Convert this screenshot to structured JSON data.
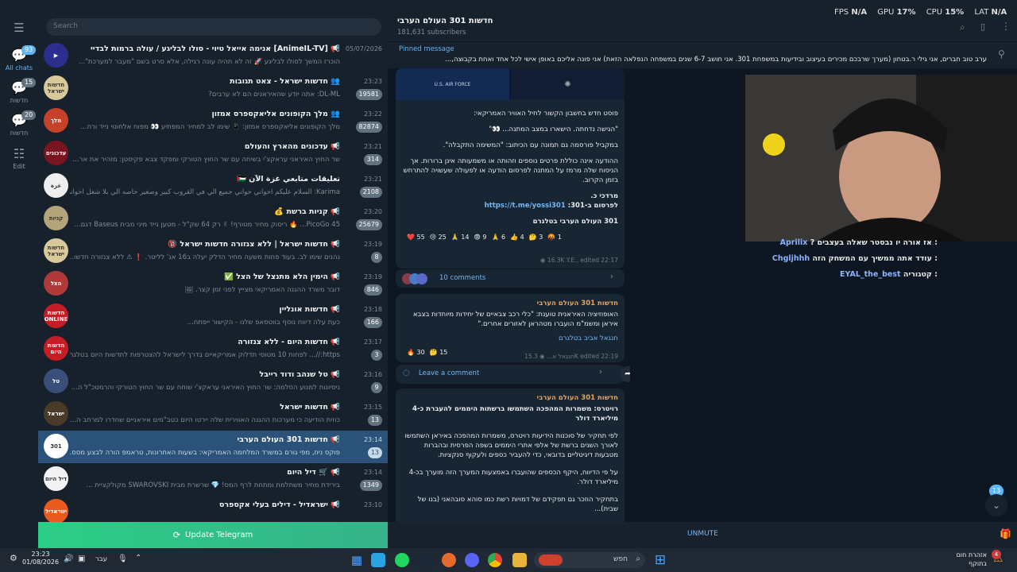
{
  "search": {
    "placeholder": "Search"
  },
  "rail": {
    "all_badge": "93",
    "all_label": "All chats",
    "f1_badge": "15",
    "f1_label": "חדשות",
    "f2_badge": "20",
    "f2_label": "חדשות",
    "edit_label": "Edit"
  },
  "chats": [
    {
      "title": "📢 [AnimeIL-TV] אנימה אייאל טיוי - סולו לבליגע / עולה ברמות לבדיי",
      "preview": "הוכרז המשך לסולו לבליגע 🚀 זה לא תהיה עונה רגילה, אלא סרט בשם \"מעבר למערכת\"...",
      "time": "05/07/2026",
      "badge": "",
      "color": "#2c2e8f",
      "av": "▶"
    },
    {
      "title": "👥 חדשות ישראל - צאט תגובות",
      "preview": "DL-ML: אתה יודע שהאיראנים הם לא ערבים?",
      "time": "23:23",
      "badge": "19581",
      "color": "#d8c89a",
      "av": "חדשות ישראל"
    },
    {
      "title": "👥 מלך הקופונים אליאקספרס אמזון",
      "preview": "מלך הקופונים אליאקספרס אמזון: 📱 שימו לב למחיר המפתיע 👀 מפוח אלחוטי נייד ורח...",
      "time": "23:22",
      "badge": "82874",
      "color": "#c6412a",
      "av": "מלך"
    },
    {
      "title": "📢 עדכונים מהארץ והעולם",
      "preview": "שר החוץ האיראני עראקצ'י בשיחה עם שר החוץ הטורקי ומפקד צבא פקיסטן: מזהיר את אר...",
      "time": "23:21",
      "badge": "314",
      "color": "#7a1420",
      "av": "עדכונים"
    },
    {
      "title": "تعليقات متابعي غزة الآن 🇵🇸",
      "preview": "Karima: السلام عليكم اخواني خواني جميع الي في القروب كبير وصغير خاصه الي بلا شغل اخواني من حا...",
      "time": "23:21",
      "badge": "2108",
      "color": "#efefef",
      "av": "غزة"
    },
    {
      "title": "📢 קניות ברשת 💰",
      "preview": "PicoGo 45... 🔥 ריסוק מחיר מטורף! ✌ רק 64 שק\"ל - מטען נייד מיני מבית Baseus דגם...",
      "time": "23:20",
      "badge": "25679",
      "color": "#b5a37a",
      "av": "קניות"
    },
    {
      "title": "📢 חדשות ישראל | ללא צנזורה חדשות ישראל 🔞",
      "preview": "נהגים שימו לב. בעוד פחות משעה מחיר הדלק יעלה ב16 אג' לליטר. ❗ ⚠ ללא צנזורה חדשו...",
      "time": "23:19",
      "badge": "8",
      "color": "#d8c89a",
      "av": "חדשות ישראל"
    },
    {
      "title": "📢 הימין הלא מתנצל של הצל ✅",
      "preview": "דובר משרד ההגנה האמריקאי מצייץ לפני זמן קצר. 🖼",
      "time": "23:19",
      "badge": "846",
      "color": "#b03a3a",
      "av": "הצל"
    },
    {
      "title": "📢 חדשות אונליין",
      "preview": "כעת עלה דיווח נוסף בווטסאפ שלנו - הקישור ייפתח...",
      "time": "23:18",
      "badge": "166",
      "color": "#c81c24",
      "av": "חדשות ONLINE"
    },
    {
      "title": "📢 חדשות היום - ללא צנזורה",
      "preview": "https://... לפחות 10 מטוסי תדלוק אמריקאיים בדרך לישראל להצטרפות לחדשות היום בטלגרם...",
      "time": "23:17",
      "badge": "3",
      "color": "#c81c24",
      "av": "חדשות היום"
    },
    {
      "title": "📢 טל שנהב ודוד רייבל",
      "preview": "ניסיונות למנוע הסלמה: שר החוץ האיראני עראקצ'י שוחח עם שר החוץ הטורקי והרמטכ\"ל ה...",
      "time": "23:16",
      "badge": "9",
      "color": "#3a4e7a",
      "av": "טל"
    },
    {
      "title": "📢 חדשות ישראל",
      "preview": "כוזית הודיעה כי מערכות ההגנה האווירית שלה יירטו היום כטב\"מים איראניים שחדרו למרחב ה...",
      "time": "23:15",
      "badge": "13",
      "color": "#4a3a2a",
      "av": "ישראל"
    },
    {
      "title": "📢 חדשות 301 העולם הערבי",
      "preview": "פוקס ניוז, מפי גורם במשרד המלחמה האמריקאי: בשעות האחרונות, טראמפ הורה לבצע מסס...",
      "time": "23:14",
      "badge": "13",
      "color": "#ffffff",
      "av": "301"
    },
    {
      "title": "📢 🛒 דיל היום",
      "preview": "בירידת מחיר משתלמת ומתחת לרף המס! 💎 שרשרת מבית SWAROVSKI מקולקציית ...",
      "time": "23:14",
      "badge": "1349",
      "color": "#f3f3f3",
      "av": "דיל היום"
    },
    {
      "title": "📢 ישראדיל - דילים בעלי אקספרס",
      "preview": "",
      "time": "23:10",
      "badge": "",
      "color": "#e95a1e",
      "av": "ישראדיל"
    }
  ],
  "update_label": "Update Telegram",
  "header": {
    "title": "חדשות 301 העולם הערבי",
    "subscribers": "181,631 subscribers"
  },
  "pinned": {
    "label": "Pinned message",
    "text": "ערב טוב חברים, אני גילי ר.בטחון (מערך שרבכם מכירים בעיצוב ובידיעות במשפחת 301. אני חושב 6-7 שנים במשפחה הנפלאה הזאת) אני פונה אליכם באופן אישי לכל אחד ואחת בקבוצה,..."
  },
  "stats": {
    "fps_label": "FPS",
    "fps": "N/A",
    "gpu_label": "GPU",
    "gpu": "17%",
    "cpu_label": "CPU",
    "cpu": "15%",
    "lat_label": "LAT",
    "lat": "N/A"
  },
  "post1": {
    "img_text": "U.S. AIR FORCE",
    "p1": "פוסט חדש בחשבון הקשור לחיל האוויר האמריקאי:",
    "p2": "\"הגישה נדחתה. הישארו במצב המתנה... 👀\"",
    "p3": "במקביל פורסמה גם תמונה עם הכיתוב: \"המשימה התקבלה\".",
    "p4": "ההודעה אינה כוללת פרטים נוספים וזהותה או משמעותה אינן ברורות. אך הניסוח שלה מרמז על המתנה לפרסום הודעה או לפעולה שעשויה להתרחש בזמן הקרוב.",
    "sign": "מרדכי כ.",
    "pub_label": "לפרסום ב-301:",
    "pub_link": "https://t.me/yossi301",
    "channel": "301 העולם הערבי בטלגרם",
    "reactions": [
      {
        "e": "❤️",
        "n": "55"
      },
      {
        "e": "😢",
        "n": "25"
      },
      {
        "e": "🙏",
        "n": "14"
      },
      {
        "e": "😨",
        "n": "9"
      },
      {
        "e": "🙏",
        "n": "6"
      },
      {
        "e": "👍",
        "n": "4"
      },
      {
        "e": "🤔",
        "n": "3"
      },
      {
        "e": "🤬",
        "n": "1"
      }
    ],
    "views": "16.3K",
    "author": "Y.E.,",
    "edited": "edited 22:17",
    "comments": "10 comments"
  },
  "post2": {
    "channel": "חדשות 301 העולם הערבי",
    "text": "האופוזיציה האיראנית טוענת: \"כלי רכב צבאיים של יחידות מיוחדות בצבא איראן ומשמ\"מ הועברו מטהראן לאזורים אחרים.\"",
    "link": "חנגאל אביב בטלגרם",
    "reactions": [
      {
        "e": "🔥",
        "n": "30"
      },
      {
        "e": "🤔",
        "n": "15"
      }
    ],
    "author": "חנגאל א...",
    "views": "15.3K",
    "edited": "edited 22:19",
    "comment": "Leave a comment"
  },
  "post3": {
    "channel": "חדשות 301 העולם הערבי",
    "headline": "רויטרס: משמרות המהפכה השתמשו ברשתות היממים להעברת כ-4 מיליארד דולר",
    "p1": "לפי תחקיר של סוכנות הידיעות רויטרס, משמרות המהפכה באיראן השתמשו לאורך השנים ברשת של אלפי אתרי היממים בשפה הפרסית ובהברות מטבעות דיגיטליים בדובאי, כדי להעביר כספים ולעקוף סנקציות.",
    "p2": "על פי הדיווח, היקף הכספים שהועברו באמצעות המערך הזה מוערך בכ-4 מיליארד דולר.",
    "p3": "בתחקיר הוזכר גם תפקידם של דמויות רשת כמו סוהא סובהאני (בנו של שבית)..."
  },
  "stream_chat": [
    {
      "user": "Aprilix",
      "text": ": אז אורה יו נבסטר שאלה בעצבים ?"
    },
    {
      "user": "Chgljhhh",
      "text": ": עודד אתה ממשיך עם המשחק הזה"
    },
    {
      "user": "EYAL_the_best",
      "text": ": קטגוריה"
    }
  ],
  "unmute": "UNMUTE",
  "scroll_badge": "13",
  "taskbar": {
    "time": "23:23",
    "date": "01/08/2026",
    "lang": "עבר",
    "search": "חפש",
    "weather_badge": "4",
    "weather_title": "אזהרת חום",
    "weather_sub": "בתוקף"
  }
}
